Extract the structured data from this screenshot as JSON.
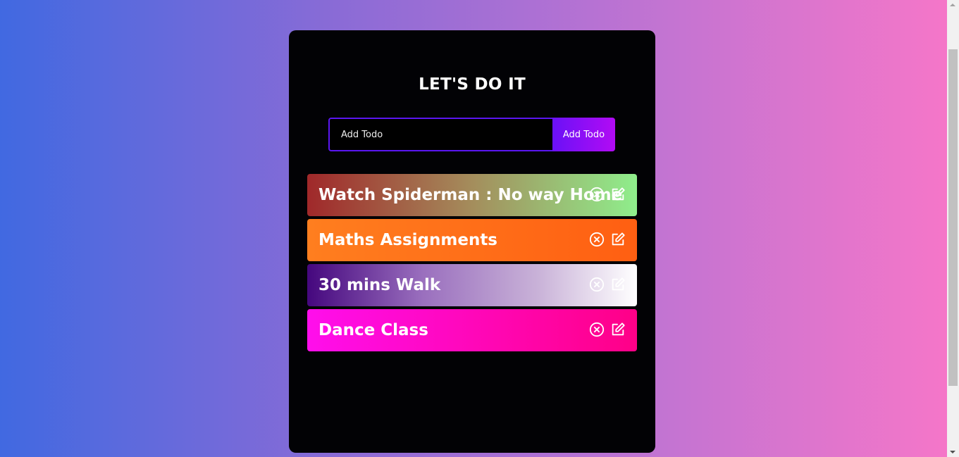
{
  "app": {
    "title": "LET'S DO IT"
  },
  "form": {
    "input_placeholder": "Add Todo",
    "button_label": "Add Todo"
  },
  "todos": [
    {
      "text": "Watch Spiderman : No way Home",
      "gradient": [
        "#a0282a",
        "#8fee8c"
      ]
    },
    {
      "text": "Maths Assignments",
      "gradient": [
        "#ff7e1f",
        "#ff5f12"
      ]
    },
    {
      "text": "30 mins Walk",
      "gradient": [
        "#45077e",
        "#ffffff"
      ]
    },
    {
      "text": "Dance Class",
      "gradient": [
        "#ff0eec",
        "#ff0087"
      ]
    }
  ],
  "icons": {
    "delete": "close-circle-icon",
    "edit": "edit-icon"
  },
  "colors": {
    "panel": "#020205",
    "input_border": "#5a16f0",
    "button_start": "#6a11f7",
    "button_end": "#b20bf4"
  }
}
